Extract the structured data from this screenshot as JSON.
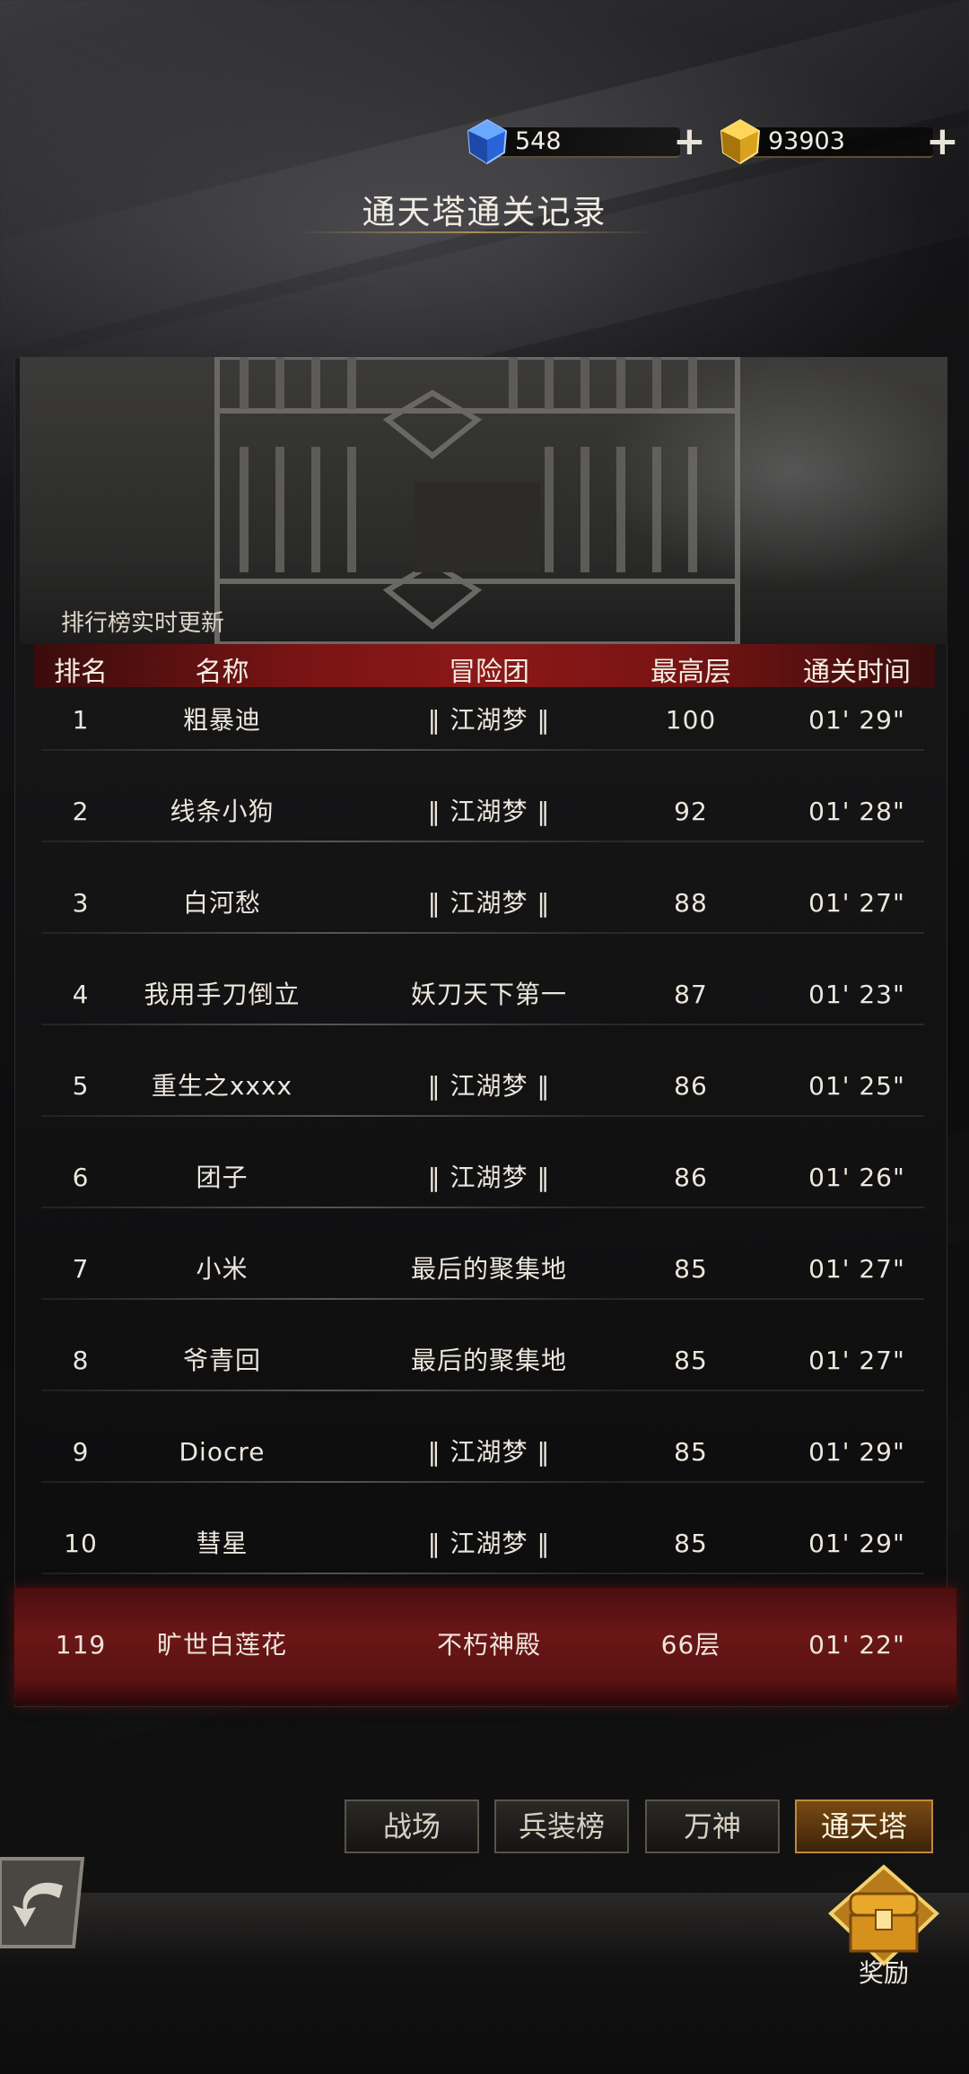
{
  "currency": {
    "gems": "548",
    "gold": "93903",
    "plus_label": "+"
  },
  "page_title": "通天塔通关记录",
  "live_note": "排行榜实时更新",
  "table": {
    "headers": [
      "排名",
      "名称",
      "冒险团",
      "最高层",
      "通关时间"
    ],
    "rows": [
      {
        "rank": "1",
        "name": "粗暴迪",
        "team": "‖ 江湖梦 ‖",
        "floor": "100",
        "time": "01' 29\""
      },
      {
        "rank": "2",
        "name": "线条小狗",
        "team": "‖ 江湖梦 ‖",
        "floor": "92",
        "time": "01' 28\""
      },
      {
        "rank": "3",
        "name": "白河愁",
        "team": "‖ 江湖梦 ‖",
        "floor": "88",
        "time": "01' 27\""
      },
      {
        "rank": "4",
        "name": "我用手刀倒立",
        "team": "妖刀天下第一",
        "floor": "87",
        "time": "01' 23\""
      },
      {
        "rank": "5",
        "name": "重生之xxxx",
        "team": "‖ 江湖梦 ‖",
        "floor": "86",
        "time": "01' 25\""
      },
      {
        "rank": "6",
        "name": "团子",
        "team": "‖ 江湖梦 ‖",
        "floor": "86",
        "time": "01' 26\""
      },
      {
        "rank": "7",
        "name": "小米",
        "team": "最后的聚集地",
        "floor": "85",
        "time": "01' 27\""
      },
      {
        "rank": "8",
        "name": "爷青回",
        "team": "最后的聚集地",
        "floor": "85",
        "time": "01' 27\""
      },
      {
        "rank": "9",
        "name": "Diocre",
        "team": "‖ 江湖梦 ‖",
        "floor": "85",
        "time": "01' 29\""
      },
      {
        "rank": "10",
        "name": "彗星",
        "team": "‖ 江湖梦 ‖",
        "floor": "85",
        "time": "01' 29\""
      }
    ],
    "self": {
      "rank": "119",
      "name": "旷世白莲花",
      "team": "不朽神殿",
      "floor": "66层",
      "time": "01' 22\""
    }
  },
  "tabs": [
    {
      "label": "战场",
      "active": false
    },
    {
      "label": "兵装榜",
      "active": false
    },
    {
      "label": "万神",
      "active": false
    },
    {
      "label": "通天塔",
      "active": true
    }
  ],
  "reward_label": "奖励",
  "icons": {
    "gem": "blue-crystal-icon",
    "gold": "gold-crystal-icon",
    "back": "back-arrow-icon",
    "reward": "treasure-chest-icon"
  },
  "colors": {
    "header_red": "#8c1818",
    "tab_active": "#7a4a14",
    "gold_accent": "#c08a3c"
  }
}
